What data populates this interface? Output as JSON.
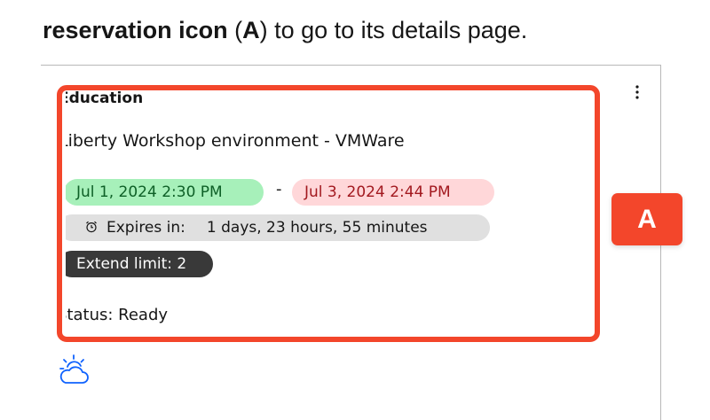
{
  "instruction": {
    "bold_text": "reservation icon",
    "label_open": " (",
    "label_letter": "A",
    "label_close": ")",
    "rest_text": " to go to its details page."
  },
  "reservation": {
    "category": "Education",
    "title": "Liberty Workshop environment - VMWare",
    "start": "Jul 1, 2024 2:30 PM",
    "separator": "-",
    "end": "Jul 3, 2024 2:44 PM",
    "expires_label": "Expires in:",
    "expires_value": "1 days, 23 hours, 55 minutes",
    "extend_limit": "Extend limit: 2",
    "status": "Status: Ready"
  },
  "annotation": {
    "marker": "A"
  },
  "colors": {
    "highlight": "#f3462b",
    "start_tag_bg": "#a7f0ba",
    "end_tag_bg": "#ffd7d9",
    "expire_tag_bg": "#e0e0e0",
    "extend_tag_bg": "#393939",
    "icon_blue": "#0f62fe"
  },
  "icons": {
    "overflow": "overflow-menu-icon",
    "alarm": "alarm-clock-icon",
    "weather": "partly-cloudy-icon"
  }
}
